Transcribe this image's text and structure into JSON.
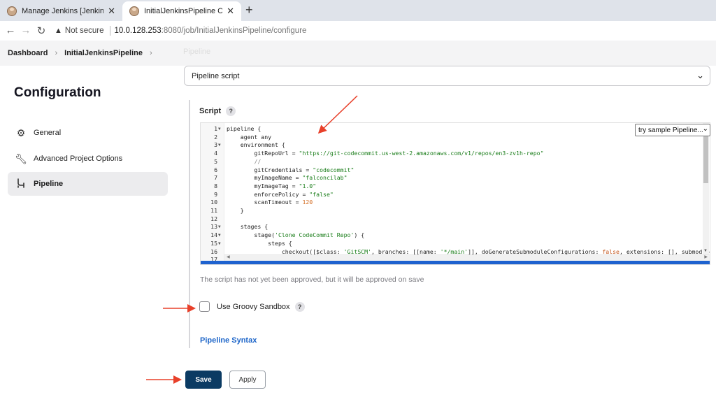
{
  "browser": {
    "tabs": [
      {
        "title": "Manage Jenkins [Jenkins]",
        "active": false
      },
      {
        "title": "InitialJenkinsPipeline Config [Jenkins]",
        "active": true
      }
    ],
    "new_tab_label": "+",
    "close_glyph": "✕",
    "security_text": "Not secure",
    "url_host": "10.0.128.253",
    "url_path": ":8080/job/InitialJenkinsPipeline/configure"
  },
  "breadcrumb": {
    "items": [
      "Dashboard",
      "InitialJenkinsPipeline"
    ]
  },
  "faded_header": "Pipeline",
  "sidebar": {
    "title": "Configuration",
    "items": [
      {
        "label": "General",
        "icon": "gear-icon",
        "active": false
      },
      {
        "label": "Advanced Project Options",
        "icon": "wrench-icon",
        "active": false
      },
      {
        "label": "Pipeline",
        "icon": "pipeline-icon",
        "active": true
      }
    ]
  },
  "definition_select": {
    "value": "Pipeline script"
  },
  "script": {
    "label": "Script",
    "help": "?",
    "sample_select": "try sample Pipeline...",
    "lines": [
      {
        "n": "1",
        "fold": true,
        "text": "pipeline {"
      },
      {
        "n": "2",
        "fold": false,
        "text": "    agent any"
      },
      {
        "n": "3",
        "fold": true,
        "text": "    environment {"
      },
      {
        "n": "4",
        "fold": false,
        "text": "        gitRepoUrl = \"https://git-codecommit.us-west-2.amazonaws.com/v1/repos/en3-zv1h-repo\""
      },
      {
        "n": "5",
        "fold": false,
        "text": "        //"
      },
      {
        "n": "6",
        "fold": false,
        "text": "        gitCredentials = \"codecommit\""
      },
      {
        "n": "7",
        "fold": false,
        "text": "        myImageName = \"falconcilab\""
      },
      {
        "n": "8",
        "fold": false,
        "text": "        myImageTag = \"1.0\""
      },
      {
        "n": "9",
        "fold": false,
        "text": "        enforcePolicy = \"false\""
      },
      {
        "n": "10",
        "fold": false,
        "text": "        scanTimeout = 120"
      },
      {
        "n": "11",
        "fold": false,
        "text": "    }"
      },
      {
        "n": "12",
        "fold": false,
        "text": ""
      },
      {
        "n": "13",
        "fold": true,
        "text": "    stages {"
      },
      {
        "n": "14",
        "fold": true,
        "text": "        stage('Clone CodeCommit Repo') {"
      },
      {
        "n": "15",
        "fold": true,
        "text": "            steps {"
      },
      {
        "n": "16",
        "fold": false,
        "text": "                checkout([$class: 'GitSCM', branches: [[name: '*/main']], doGenerateSubmoduleConfigurations: false, extensions: [], submoduleCfg: [], u"
      },
      {
        "n": "17",
        "fold": false,
        "text": "                }"
      }
    ]
  },
  "approval_note": "The script has not yet been approved, but it will be approved on save",
  "sandbox": {
    "label": "Use Groovy Sandbox",
    "checked": false,
    "help": "?"
  },
  "pipeline_syntax_link": "Pipeline Syntax",
  "buttons": {
    "save": "Save",
    "apply": "Apply"
  },
  "colors": {
    "save_bg": "#0b3b63",
    "link": "#1e66c9",
    "annotation_arrow": "#e8402a",
    "editor_accent": "#1e62cf"
  }
}
